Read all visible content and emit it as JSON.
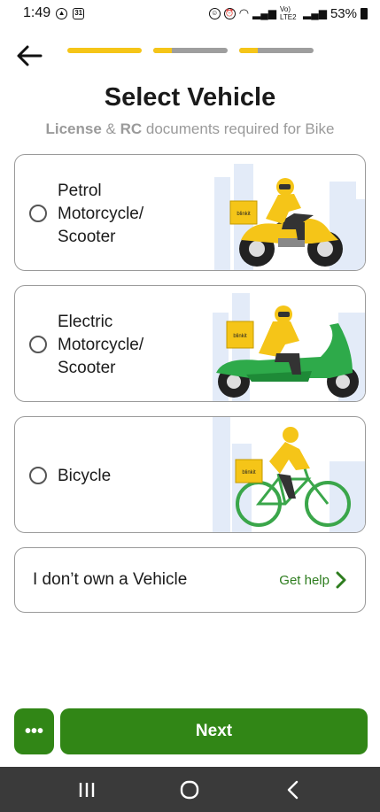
{
  "status_bar": {
    "time": "1:49",
    "calendar_day": "31",
    "network_label": "Vo) LTE2",
    "battery_percent": "53%"
  },
  "header": {
    "progress_steps": [
      1.0,
      0.25,
      0.25
    ]
  },
  "page": {
    "title": "Select Vehicle",
    "subtitle_part1": "License",
    "subtitle_part2": " & ",
    "subtitle_part3": "RC",
    "subtitle_part4": " documents required for Bike"
  },
  "options": [
    {
      "label": "Petrol\nMotorcycle/\nScooter"
    },
    {
      "label": "Electric\nMotorcycle/\nScooter"
    },
    {
      "label": "Bicycle"
    }
  ],
  "art": {
    "box_text": "blinkit",
    "rider_color": "#f5c518",
    "skyline_color": "#e3ebf8"
  },
  "no_vehicle": {
    "label": "I don’t own a Vehicle",
    "help": "Get help"
  },
  "footer": {
    "more_label": "•••",
    "next_label": "Next"
  },
  "colors": {
    "primary_green": "#318616",
    "progress_yellow": "#f5c518",
    "progress_grey": "#9e9e9e",
    "help_green": "#2e7d1f"
  },
  "icons": [
    "back-arrow-icon",
    "chevron-right-icon",
    "recent-apps-icon",
    "home-icon",
    "nav-back-icon"
  ]
}
